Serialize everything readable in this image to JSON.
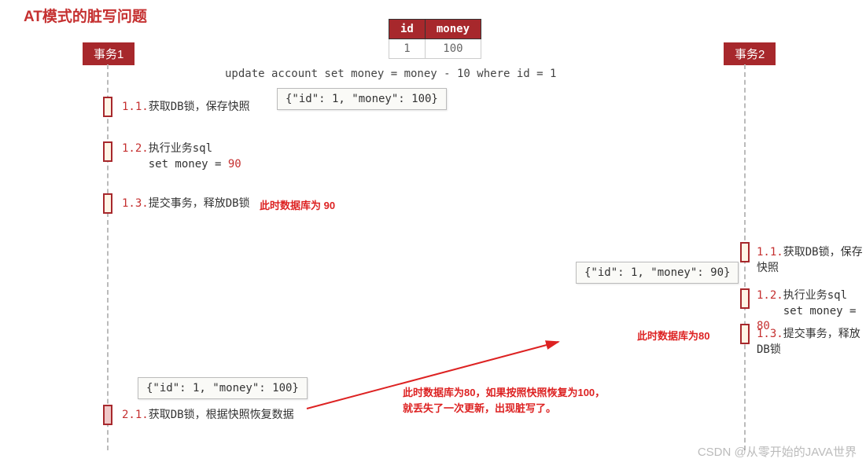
{
  "title": "AT模式的脏写问题",
  "table": {
    "headers": [
      "id",
      "money"
    ],
    "row": [
      "1",
      "100"
    ]
  },
  "sql": "update account set money = money - 10 where id = 1",
  "lanes": {
    "tx1": "事务1",
    "tx2": "事务2"
  },
  "tx1": {
    "s1": {
      "num": "1.1.",
      "text": "获取DB锁，保存快照"
    },
    "s2": {
      "num": "1.2.",
      "text": "执行业务sql",
      "sub": "set money = ",
      "subval": "90"
    },
    "s3": {
      "num": "1.3.",
      "text": "提交事务，释放DB锁"
    },
    "note3": "此时数据库为 90",
    "s4": {
      "num": "2.1.",
      "text": "获取DB锁，根据快照恢复数据"
    }
  },
  "tx2": {
    "s1": {
      "num": "1.1.",
      "text": "获取DB锁，保存快照"
    },
    "s2": {
      "num": "1.2.",
      "text": "执行业务sql",
      "sub": "set money = ",
      "subval": "80"
    },
    "s3": {
      "num": "1.3.",
      "text": "提交事务，释放DB锁"
    },
    "note": "此时数据库为80"
  },
  "snapshot1": "{\"id\": 1, \"money\": 100}",
  "snapshot2": "{\"id\": 1, \"money\": 90}",
  "snapshot3": "{\"id\": 1, \"money\": 100}",
  "warn": {
    "line1": "此时数据库为80，如果按照快照恢复为100，",
    "line2": "就丢失了一次更新，出现脏写了。"
  },
  "watermark": "CSDN @从零开始的JAVA世界"
}
